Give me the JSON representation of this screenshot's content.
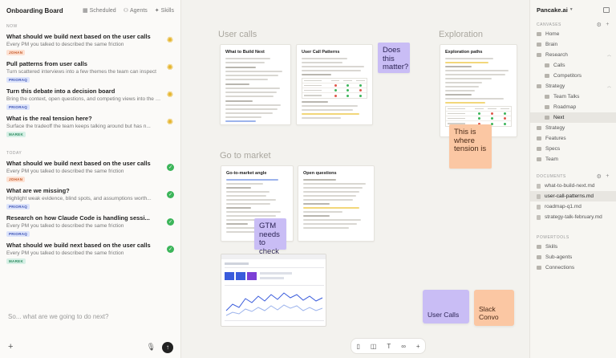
{
  "left": {
    "board_title": "Onboarding Board",
    "tabs": [
      {
        "label": "Scheduled",
        "icon": "calendar-icon"
      },
      {
        "label": "Agents",
        "icon": "person-icon"
      },
      {
        "label": "Skills",
        "icon": "sparkle-icon"
      }
    ],
    "sections": [
      {
        "label": "NOW",
        "items": [
          {
            "title": "What should we build next based on the user calls",
            "subtitle": "Every PM you talked to described the same friction",
            "tag": "JOHAN",
            "status": "running"
          },
          {
            "title": "Pull patterns from user calls",
            "subtitle": "Turn scattered interviews into a few themes the team can inspect",
            "tag": "PRIORAQ",
            "status": "running"
          },
          {
            "title": "Turn this debate into a decision board",
            "subtitle": "Bring the context, open questions, and competing views into the b...",
            "tag": "PRIORAQ",
            "status": "running"
          },
          {
            "title": "What is the real tension here?",
            "subtitle": "Surface the tradeoff the team keeps talking around but has n...",
            "tag": "MAREK",
            "status": "running"
          }
        ]
      },
      {
        "label": "TODAY",
        "items": [
          {
            "title": "What should we build next based on the user calls",
            "subtitle": "Every PM you talked to described the same friction",
            "tag": "JOHAN",
            "status": "done"
          },
          {
            "title": "What are we missing?",
            "subtitle": "Highlight weak evidence, blind spots, and assumptions worth...",
            "tag": "PRIORAQ",
            "status": "done"
          },
          {
            "title": "Research on how Claude Code is handling sessi...",
            "subtitle": "Every PM you talked to described the same friction",
            "tag": "PRIORAQ",
            "status": "done"
          },
          {
            "title": "What should we build next based on the user calls",
            "subtitle": "Every PM you talked to described the same friction",
            "tag": "MAREK",
            "status": "done"
          }
        ]
      }
    ],
    "composer": {
      "placeholder": "So... what are we going to do next?"
    }
  },
  "canvas": {
    "sections": {
      "user_calls": "User calls",
      "exploration": "Exploration",
      "go_to_market": "Go to market"
    },
    "docs": {
      "what_to_build": "What to Build Next",
      "user_call_patterns": "User Call Patterns",
      "exploration_paths": "Exploration paths",
      "gtm_angle": "Go-to-market angle",
      "open_questions": "Open questions"
    },
    "stickies": {
      "does_this_matter": "Does this matter?",
      "tension": "This is where tension is",
      "gtm_check": "GTM needs to check"
    },
    "cards": {
      "user_calls": "User Calls",
      "slack_convo": "Slack Convo"
    },
    "toolbar": [
      "doc-icon",
      "note-icon",
      "text-icon",
      "link-icon",
      "add-icon"
    ]
  },
  "right": {
    "workspace": "Pancake.ai",
    "canvases_label": "CANVASES",
    "canvases": [
      {
        "label": "Home",
        "level": 0
      },
      {
        "label": "Brain",
        "level": 0
      },
      {
        "label": "Research",
        "level": 0,
        "expanded": true
      },
      {
        "label": "Calls",
        "level": 1
      },
      {
        "label": "Competitors",
        "level": 1
      },
      {
        "label": "Strategy",
        "level": 0,
        "expanded": true
      },
      {
        "label": "Team Talks",
        "level": 1
      },
      {
        "label": "Roadmap",
        "level": 1
      },
      {
        "label": "Next",
        "level": 1,
        "active": true
      },
      {
        "label": "Strategy",
        "level": 0
      },
      {
        "label": "Features",
        "level": 0
      },
      {
        "label": "Specs",
        "level": 0
      },
      {
        "label": "Team",
        "level": 0
      }
    ],
    "documents_label": "DOCUMENTS",
    "documents": [
      {
        "label": "what-to-build-next.md",
        "active": false
      },
      {
        "label": "user-call-patterns.md",
        "active": true
      },
      {
        "label": "roadmap-q1.md",
        "active": false
      },
      {
        "label": "strategy-talk-february.md",
        "active": false
      }
    ],
    "powertools_label": "POWERTOOLS",
    "powertools": [
      {
        "label": "Skills"
      },
      {
        "label": "Sub-agents"
      },
      {
        "label": "Connections"
      }
    ]
  },
  "colors": {
    "accent_purple": "#c9bdf5",
    "accent_peach": "#fbc7a3",
    "done_green": "#3cb55a",
    "running_yellow": "#e6b42a"
  }
}
